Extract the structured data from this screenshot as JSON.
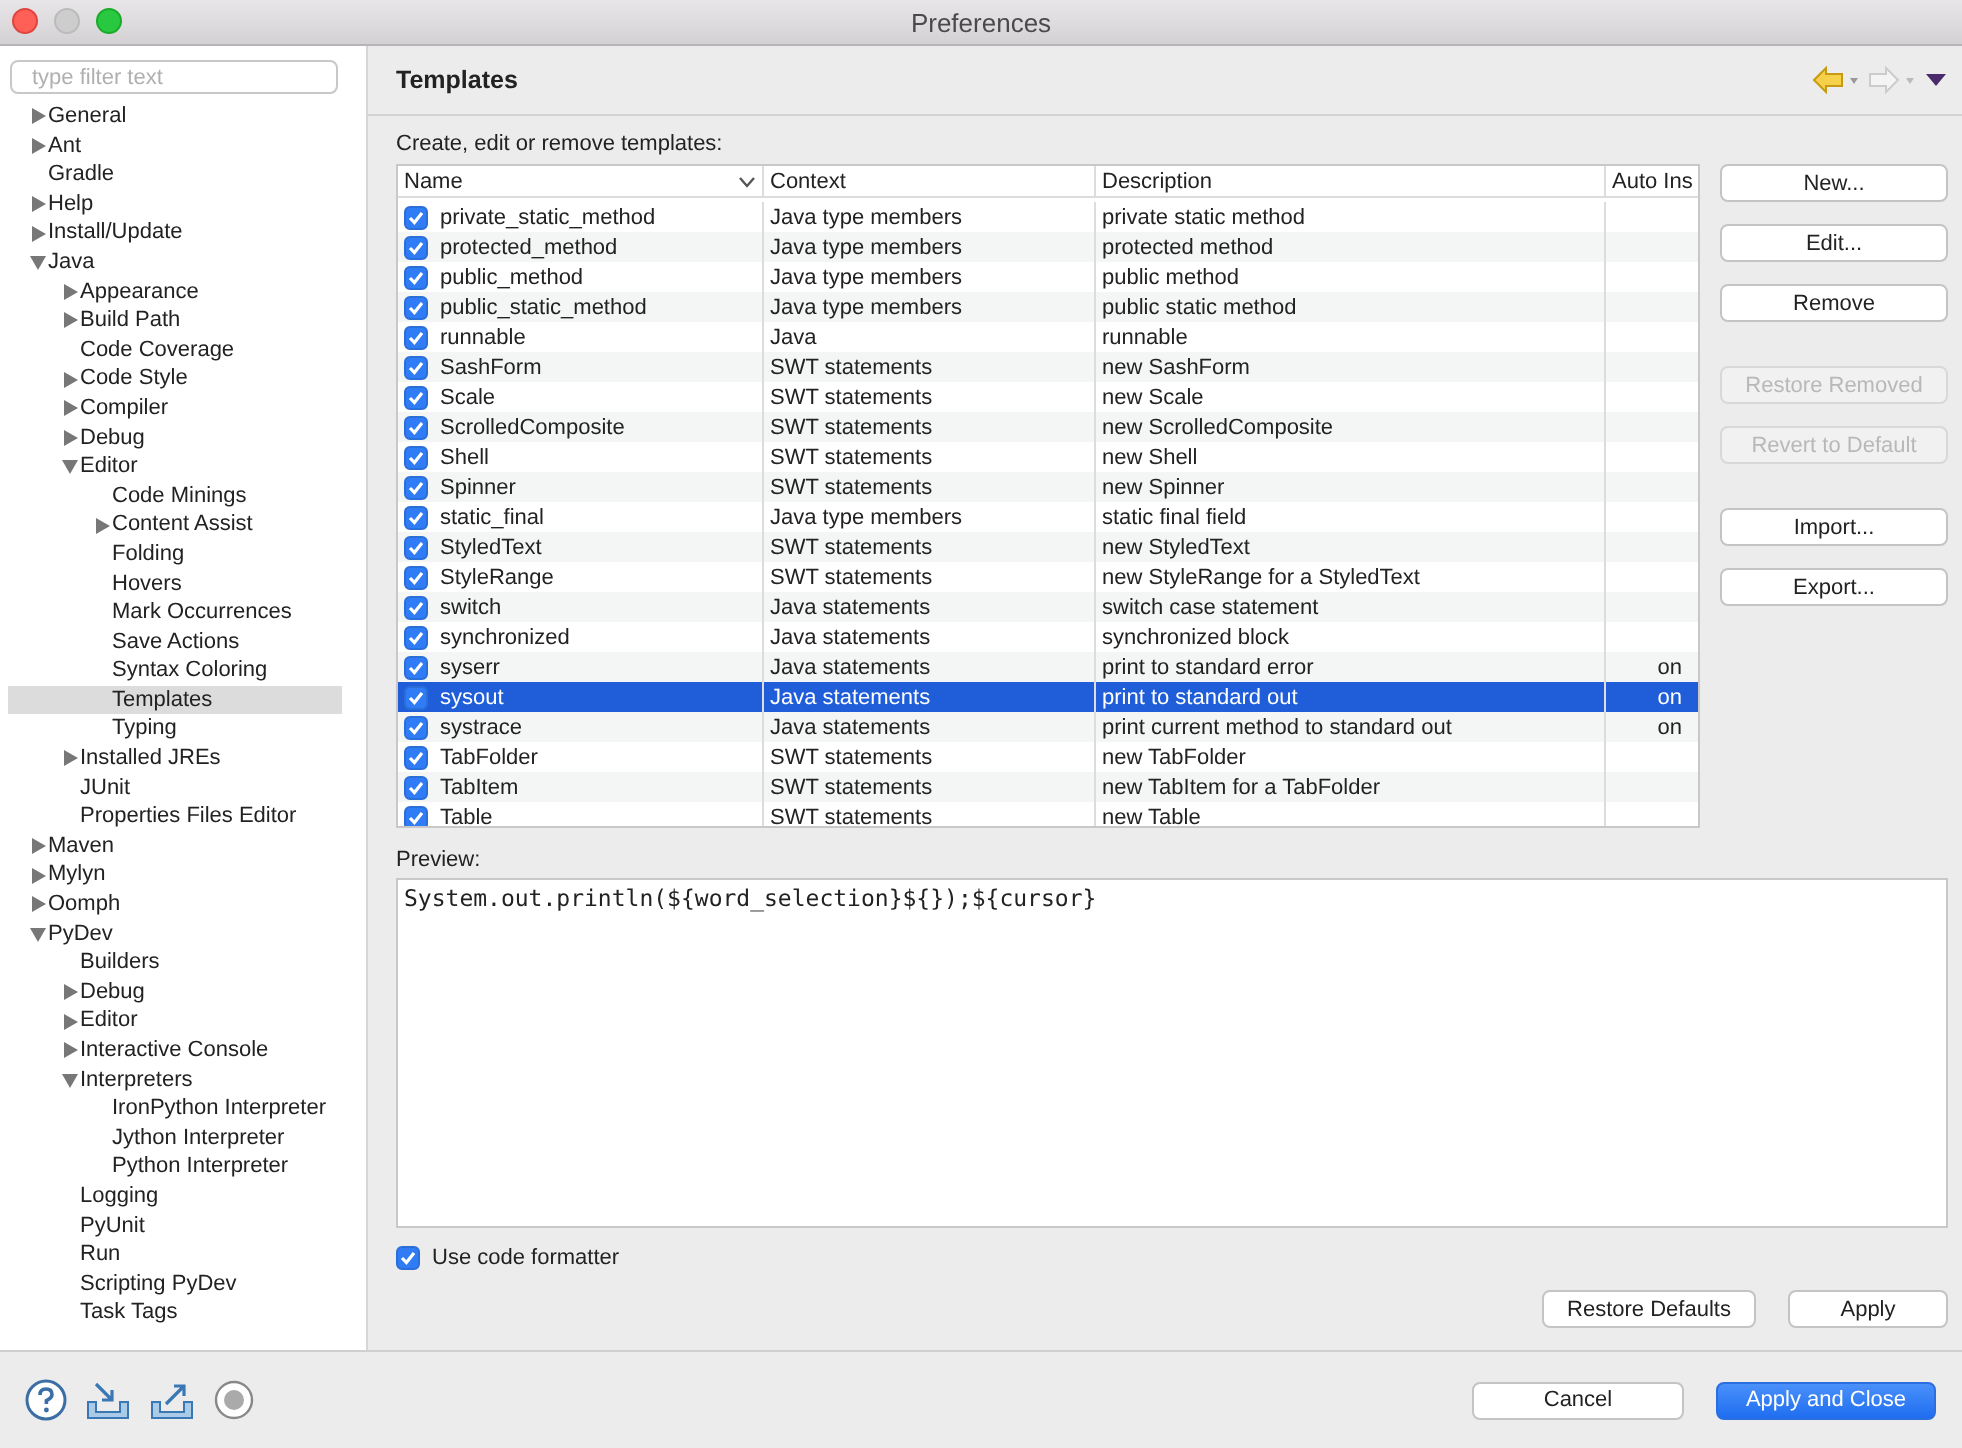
{
  "window": {
    "title": "Preferences"
  },
  "sidebar": {
    "filter": {
      "placeholder": "type filter text"
    },
    "tree": [
      {
        "label": "General",
        "expanded": false,
        "has_children": true,
        "selected": false
      },
      {
        "label": "Ant",
        "expanded": false,
        "has_children": true,
        "selected": false
      },
      {
        "label": "Gradle",
        "has_children": false,
        "selected": false
      },
      {
        "label": "Help",
        "expanded": false,
        "has_children": true,
        "selected": false
      },
      {
        "label": "Install/Update",
        "expanded": false,
        "has_children": true,
        "selected": false
      },
      {
        "label": "Java",
        "expanded": true,
        "has_children": true,
        "selected": false,
        "children": [
          {
            "label": "Appearance",
            "expanded": false,
            "has_children": true,
            "selected": false
          },
          {
            "label": "Build Path",
            "expanded": false,
            "has_children": true,
            "selected": false
          },
          {
            "label": "Code Coverage",
            "has_children": false,
            "selected": false
          },
          {
            "label": "Code Style",
            "expanded": false,
            "has_children": true,
            "selected": false
          },
          {
            "label": "Compiler",
            "expanded": false,
            "has_children": true,
            "selected": false
          },
          {
            "label": "Debug",
            "expanded": false,
            "has_children": true,
            "selected": false
          },
          {
            "label": "Editor",
            "expanded": true,
            "has_children": true,
            "selected": false,
            "children": [
              {
                "label": "Code Minings",
                "has_children": false,
                "selected": false
              },
              {
                "label": "Content Assist",
                "expanded": false,
                "has_children": true,
                "selected": false
              },
              {
                "label": "Folding",
                "has_children": false,
                "selected": false
              },
              {
                "label": "Hovers",
                "has_children": false,
                "selected": false
              },
              {
                "label": "Mark Occurrences",
                "has_children": false,
                "selected": false
              },
              {
                "label": "Save Actions",
                "has_children": false,
                "selected": false
              },
              {
                "label": "Syntax Coloring",
                "has_children": false,
                "selected": false
              },
              {
                "label": "Templates",
                "has_children": false,
                "selected": true
              },
              {
                "label": "Typing",
                "has_children": false,
                "selected": false
              }
            ]
          },
          {
            "label": "Installed JREs",
            "expanded": false,
            "has_children": true,
            "selected": false
          },
          {
            "label": "JUnit",
            "has_children": false,
            "selected": false
          },
          {
            "label": "Properties Files Editor",
            "has_children": false,
            "selected": false
          }
        ]
      },
      {
        "label": "Maven",
        "expanded": false,
        "has_children": true,
        "selected": false
      },
      {
        "label": "Mylyn",
        "expanded": false,
        "has_children": true,
        "selected": false
      },
      {
        "label": "Oomph",
        "expanded": false,
        "has_children": true,
        "selected": false
      },
      {
        "label": "PyDev",
        "expanded": true,
        "has_children": true,
        "selected": false,
        "children": [
          {
            "label": "Builders",
            "has_children": false,
            "selected": false
          },
          {
            "label": "Debug",
            "expanded": false,
            "has_children": true,
            "selected": false
          },
          {
            "label": "Editor",
            "expanded": false,
            "has_children": true,
            "selected": false
          },
          {
            "label": "Interactive Console",
            "expanded": false,
            "has_children": true,
            "selected": false
          },
          {
            "label": "Interpreters",
            "expanded": true,
            "has_children": true,
            "selected": false,
            "children": [
              {
                "label": "IronPython Interpreter",
                "has_children": false,
                "selected": false
              },
              {
                "label": "Jython Interpreter",
                "has_children": false,
                "selected": false
              },
              {
                "label": "Python Interpreter",
                "has_children": false,
                "selected": false
              }
            ]
          },
          {
            "label": "Logging",
            "has_children": false,
            "selected": false
          },
          {
            "label": "PyUnit",
            "has_children": false,
            "selected": false
          },
          {
            "label": "Run",
            "has_children": false,
            "selected": false
          },
          {
            "label": "Scripting PyDev",
            "has_children": false,
            "selected": false
          },
          {
            "label": "Task Tags",
            "has_children": false,
            "selected": false
          }
        ]
      }
    ]
  },
  "page": {
    "title": "Templates",
    "description": "Create, edit or remove templates:",
    "table": {
      "columns": [
        "Name",
        "Context",
        "Description",
        "Auto Ins"
      ],
      "rows": [
        {
          "name": "private_static_method",
          "context": "Java type members",
          "description": "private static method",
          "auto_insert": "",
          "checked": true,
          "selected": false
        },
        {
          "name": "protected_method",
          "context": "Java type members",
          "description": "protected method",
          "auto_insert": "",
          "checked": true,
          "selected": false
        },
        {
          "name": "public_method",
          "context": "Java type members",
          "description": "public method",
          "auto_insert": "",
          "checked": true,
          "selected": false
        },
        {
          "name": "public_static_method",
          "context": "Java type members",
          "description": "public static method",
          "auto_insert": "",
          "checked": true,
          "selected": false
        },
        {
          "name": "runnable",
          "context": "Java",
          "description": "runnable",
          "auto_insert": "",
          "checked": true,
          "selected": false
        },
        {
          "name": "SashForm",
          "context": "SWT statements",
          "description": "new SashForm",
          "auto_insert": "",
          "checked": true,
          "selected": false
        },
        {
          "name": "Scale",
          "context": "SWT statements",
          "description": "new Scale",
          "auto_insert": "",
          "checked": true,
          "selected": false
        },
        {
          "name": "ScrolledComposite",
          "context": "SWT statements",
          "description": "new ScrolledComposite",
          "auto_insert": "",
          "checked": true,
          "selected": false
        },
        {
          "name": "Shell",
          "context": "SWT statements",
          "description": "new Shell",
          "auto_insert": "",
          "checked": true,
          "selected": false
        },
        {
          "name": "Spinner",
          "context": "SWT statements",
          "description": "new Spinner",
          "auto_insert": "",
          "checked": true,
          "selected": false
        },
        {
          "name": "static_final",
          "context": "Java type members",
          "description": "static final field",
          "auto_insert": "",
          "checked": true,
          "selected": false
        },
        {
          "name": "StyledText",
          "context": "SWT statements",
          "description": "new StyledText",
          "auto_insert": "",
          "checked": true,
          "selected": false
        },
        {
          "name": "StyleRange",
          "context": "SWT statements",
          "description": "new StyleRange for a StyledText",
          "auto_insert": "",
          "checked": true,
          "selected": false
        },
        {
          "name": "switch",
          "context": "Java statements",
          "description": "switch case statement",
          "auto_insert": "",
          "checked": true,
          "selected": false
        },
        {
          "name": "synchronized",
          "context": "Java statements",
          "description": "synchronized block",
          "auto_insert": "",
          "checked": true,
          "selected": false
        },
        {
          "name": "syserr",
          "context": "Java statements",
          "description": "print to standard error",
          "auto_insert": "on",
          "checked": true,
          "selected": false
        },
        {
          "name": "sysout",
          "context": "Java statements",
          "description": "print to standard out",
          "auto_insert": "on",
          "checked": true,
          "selected": true
        },
        {
          "name": "systrace",
          "context": "Java statements",
          "description": "print current method to standard out",
          "auto_insert": "on",
          "checked": true,
          "selected": false
        },
        {
          "name": "TabFolder",
          "context": "SWT statements",
          "description": "new TabFolder",
          "auto_insert": "",
          "checked": true,
          "selected": false
        },
        {
          "name": "TabItem",
          "context": "SWT statements",
          "description": "new TabItem for a TabFolder",
          "auto_insert": "",
          "checked": true,
          "selected": false
        },
        {
          "name": "Table",
          "context": "SWT statements",
          "description": "new Table",
          "auto_insert": "",
          "checked": true,
          "selected": false
        }
      ]
    },
    "side_buttons": [
      {
        "label": "New...",
        "disabled": false
      },
      {
        "label": "Edit...",
        "disabled": false
      },
      {
        "label": "Remove",
        "disabled": false
      },
      {
        "label": "Restore Removed",
        "disabled": true
      },
      {
        "label": "Revert to Default",
        "disabled": true
      },
      {
        "label": "Import...",
        "disabled": false
      },
      {
        "label": "Export...",
        "disabled": false
      }
    ],
    "preview": {
      "label": "Preview:",
      "code": "System.out.println(${word_selection}${});${cursor}"
    },
    "use_code_formatter": {
      "label": "Use code formatter",
      "checked": true
    },
    "buttons": [
      "Restore Defaults",
      "Apply"
    ]
  },
  "footer": {
    "buttons": [
      {
        "label": "Cancel",
        "primary": false
      },
      {
        "label": "Apply and Close",
        "primary": true
      }
    ]
  }
}
